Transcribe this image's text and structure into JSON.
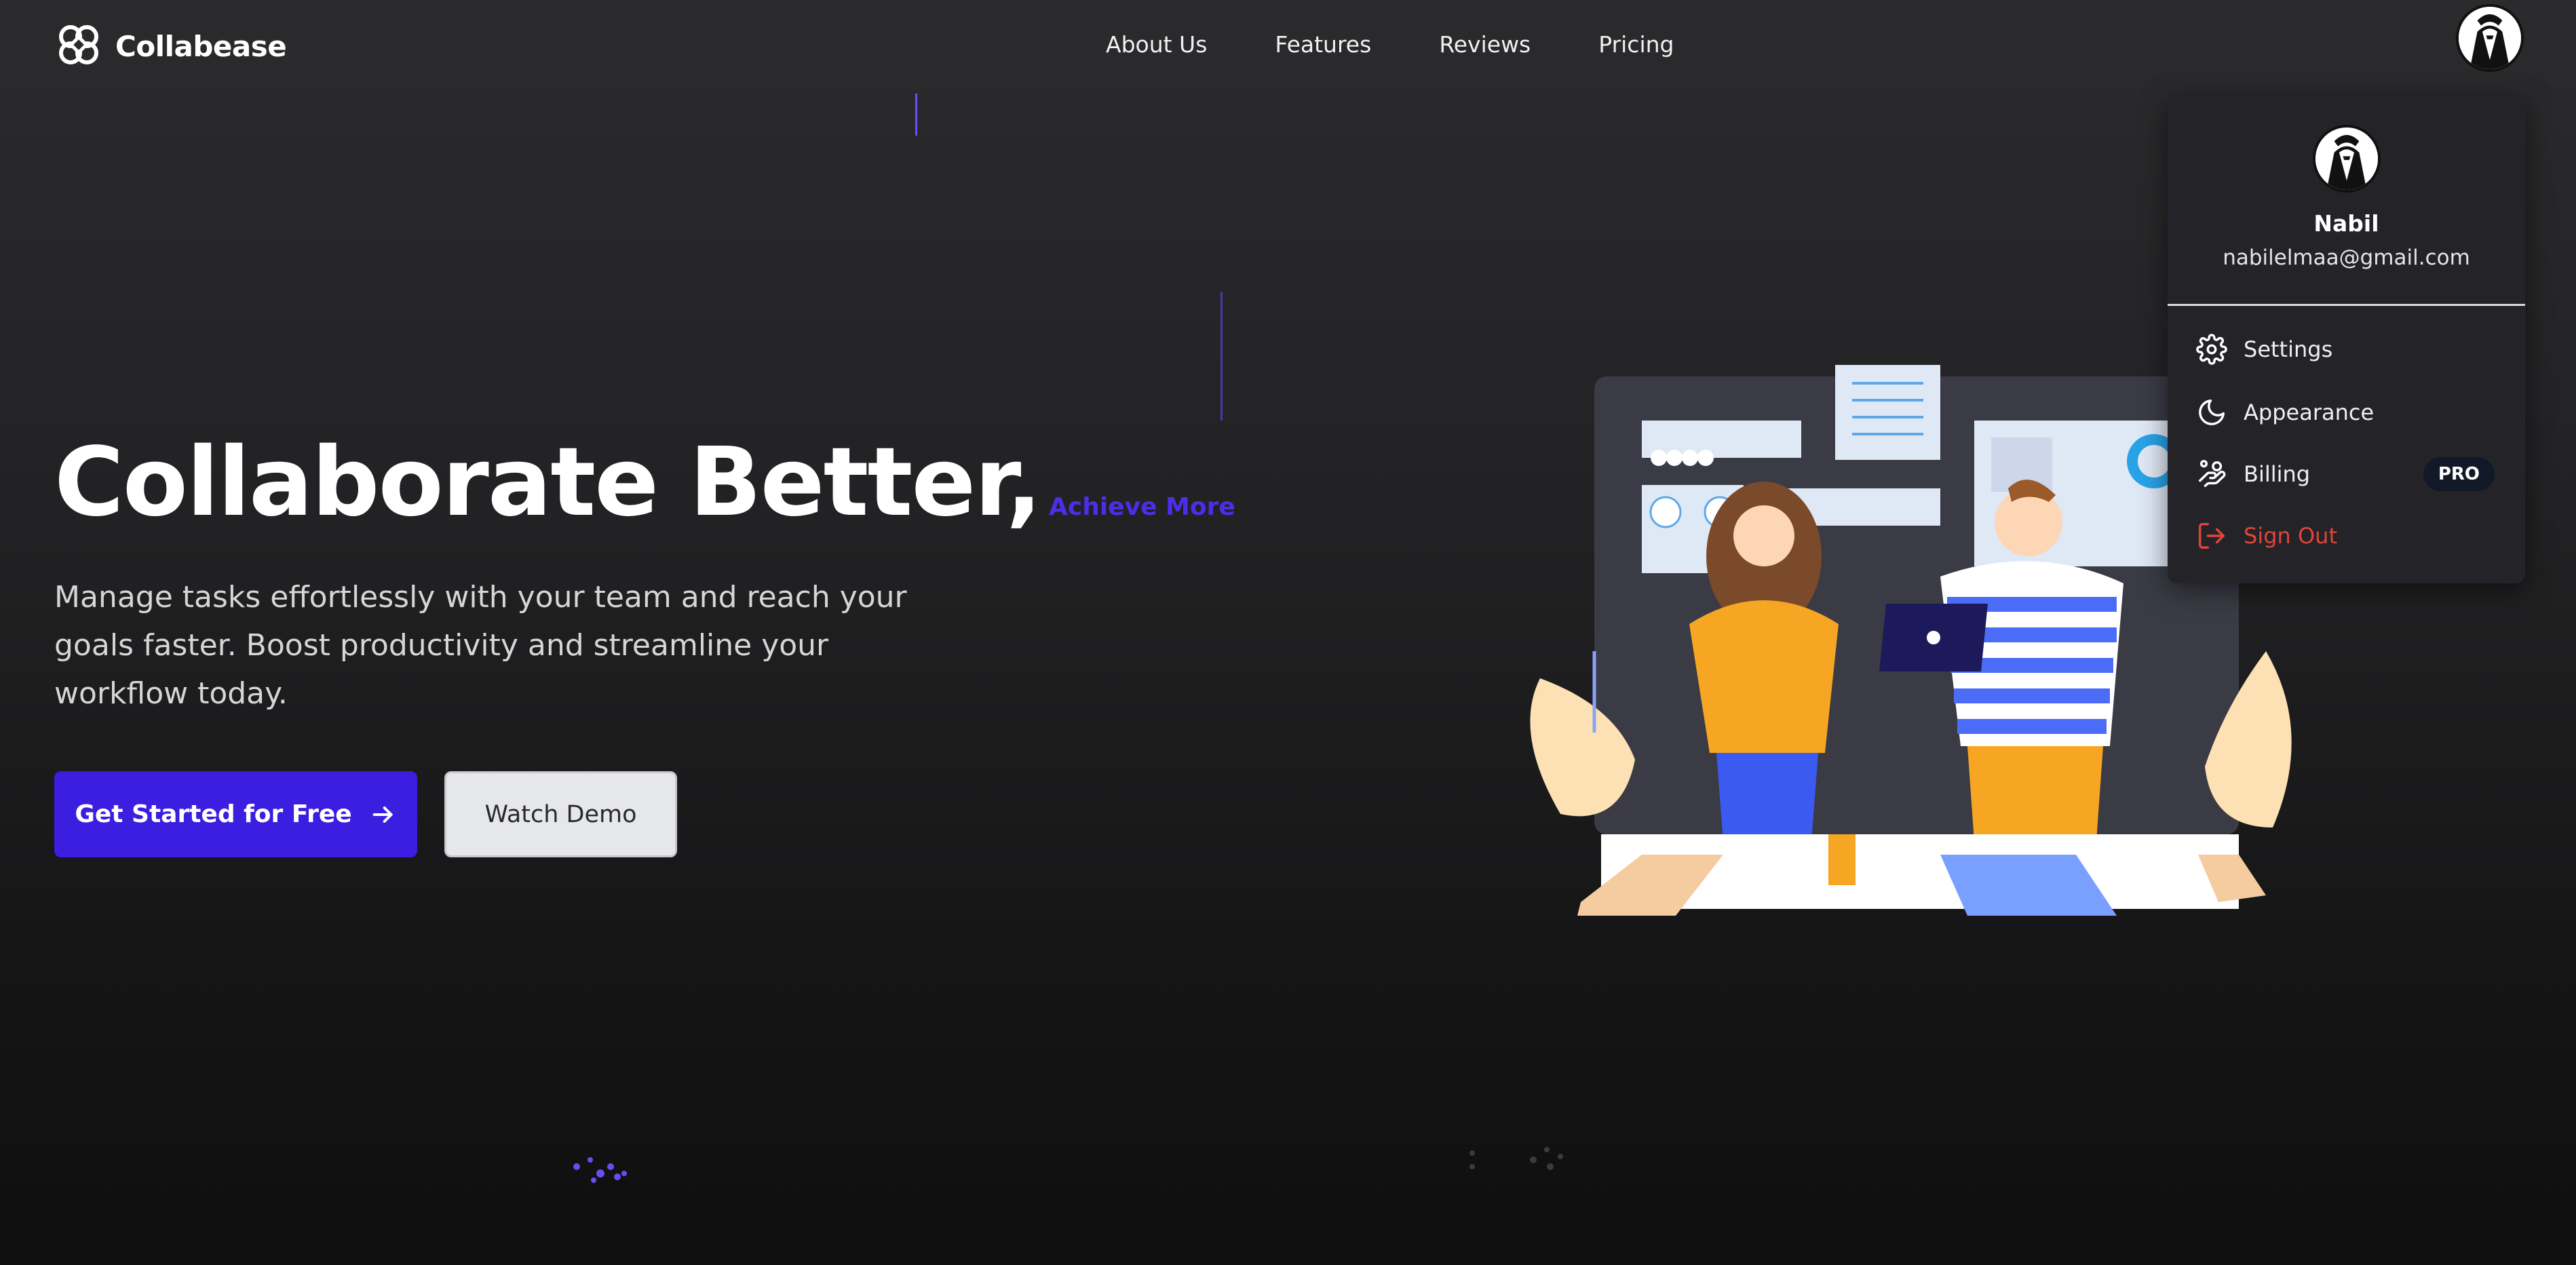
{
  "brand": {
    "name": "Collabease",
    "logo_icon": "clover-logo-icon"
  },
  "nav": {
    "links": [
      "About Us",
      "Features",
      "Reviews",
      "Pricing"
    ]
  },
  "user": {
    "avatar_icon": "tuxedo-avatar-icon"
  },
  "hero": {
    "title": "Collaborate Better,",
    "accent": "Achieve More",
    "description": "Manage tasks effortlessly with your team and reach your goals faster. Boost productivity and streamline your workflow today.",
    "cta_primary": "Get Started for Free",
    "cta_secondary": "Watch Demo"
  },
  "menu": {
    "name": "Nabil",
    "email": "nabilelmaa@gmail.com",
    "items": [
      {
        "label": "Settings",
        "icon": "gear-icon"
      },
      {
        "label": "Appearance",
        "icon": "moon-icon"
      },
      {
        "label": "Billing",
        "icon": "billing-icon",
        "badge": "PRO"
      },
      {
        "label": "Sign Out",
        "icon": "sign-out-icon"
      }
    ]
  },
  "colors": {
    "accent": "#3b1ee0",
    "accent_text": "#4b2ee8",
    "danger": "#e0443a",
    "badge_bg": "#111827"
  }
}
